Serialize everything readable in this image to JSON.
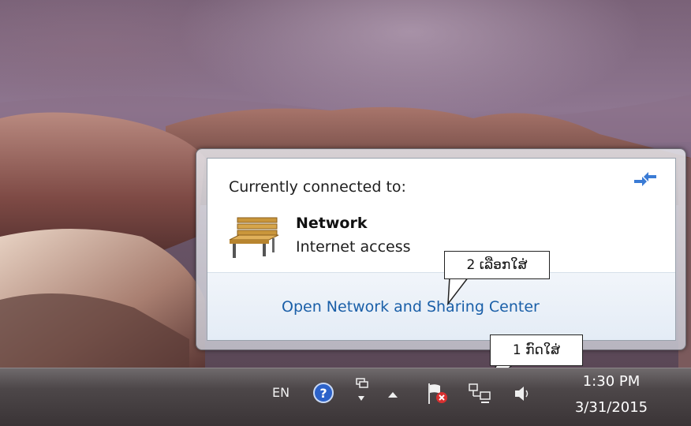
{
  "popup": {
    "heading": "Currently connected to:",
    "network_name": "Network",
    "network_status": "Internet access",
    "footer_link": "Open Network and Sharing Center"
  },
  "callouts": {
    "step2": "2 ເລືອກໃສ່",
    "step1": "1 ກົດໃສ່"
  },
  "taskbar": {
    "language": "EN",
    "time": "1:30 PM",
    "date": "3/31/2015",
    "tray_icons": [
      "help-icon",
      "display-icon",
      "show-hidden-icons-chevron",
      "action-center-flag-icon",
      "network-icon",
      "volume-icon"
    ]
  },
  "colors": {
    "link": "#1a5fa8",
    "taskbar": "#3a3436",
    "popup_footer": "#e9eff7"
  }
}
